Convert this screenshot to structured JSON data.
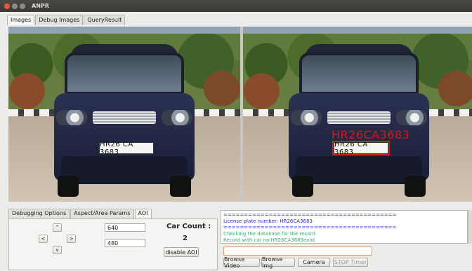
{
  "window": {
    "title": "ANPR"
  },
  "tabs": [
    "Images",
    "Debug Images",
    "QueryResult"
  ],
  "images": {
    "plate_text": "HR26CA3683",
    "plate_display": "HR26 CA 3683",
    "detected_text": "HR26CA3683"
  },
  "bottom_tabs": [
    "Debugging Options",
    "Aspect/Area Params",
    "AOI"
  ],
  "aoi": {
    "up": "^",
    "left": "<",
    "right": ">",
    "down": "v",
    "width_value": "640",
    "height_value": "480",
    "car_count_label": "Car Count :",
    "car_count_value": "2",
    "disable_aoi_label": "disable AOI"
  },
  "log": {
    "sep1": "==========================================",
    "plate_line": "License plate number: HR26CA3683",
    "sep2": "==========================================",
    "checking": "Checking the database for the record",
    "record": "Record with car no.HR26CA3683exist"
  },
  "buttons": {
    "browse_video": "Browse Video",
    "browse_img": "Browse Img",
    "camera": "Camera",
    "stop_timer": "STOP Timer"
  },
  "colors": {
    "accent_red": "#d11a1a",
    "log_blue": "#2a2ad1",
    "log_green": "#2fb36c"
  }
}
